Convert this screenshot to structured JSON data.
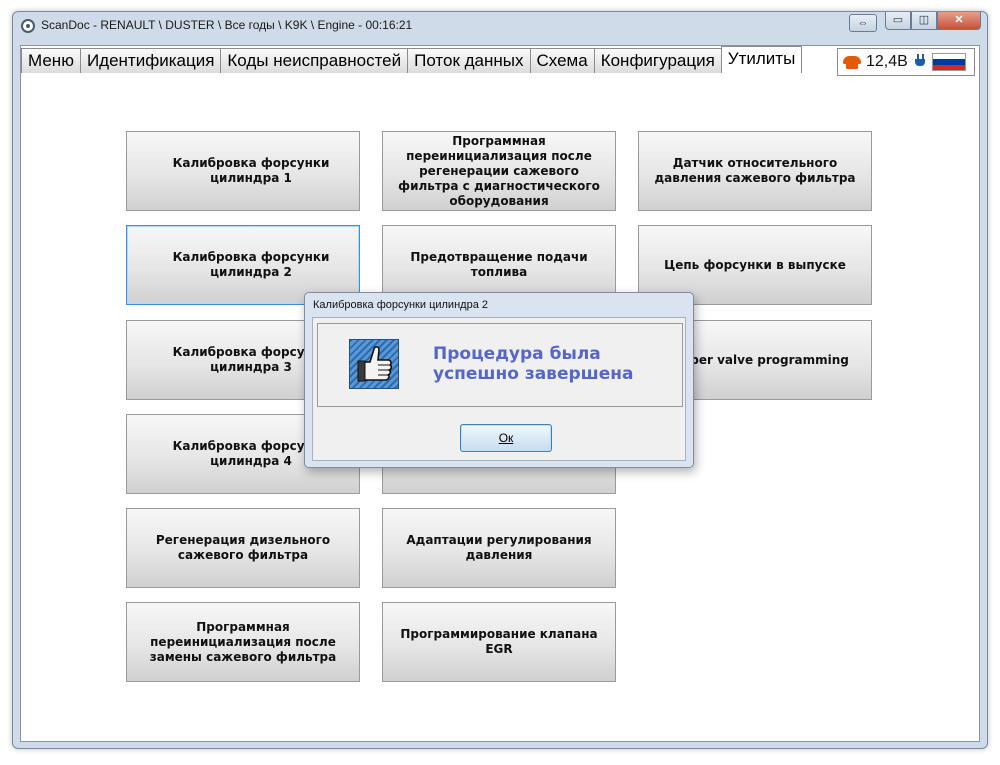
{
  "window": {
    "title": "ScanDoc - RENAULT \\ DUSTER \\ Все годы \\ K9K \\ Engine - 00:16:21"
  },
  "tabs": [
    {
      "label": "Меню"
    },
    {
      "label": "Идентификация"
    },
    {
      "label": "Коды неисправностей"
    },
    {
      "label": "Поток данных"
    },
    {
      "label": "Схема"
    },
    {
      "label": "Конфигурация"
    },
    {
      "label": "Утилиты",
      "active": true
    }
  ],
  "status": {
    "voltage": "12,4В",
    "colors": {
      "phone": "#e25b0b",
      "plug": "#1e5ea8"
    },
    "flag_colors": [
      "#ffffff",
      "#0039a6",
      "#d52b1e"
    ]
  },
  "functions": [
    "Калибровка форсунки цилиндра 1",
    "Программная переинициализация после регенерации сажевого фильтра с диагностического оборудования",
    "Датчик относительного давления сажевого фильтра",
    "Калибровка форсунки цилиндра 2",
    "Предотвращение подачи топлива",
    "Цепь форсунки в выпуске",
    "Калибровка форсунки цилиндра 3",
    "damper valve programming",
    "Калибровка форсунки цилиндра 4",
    "Регенерация дизельного сажевого фильтра",
    "Адаптации регулирования давления",
    "Программная переинициализация после замены сажевого фильтра",
    "Программирование клапана EGR"
  ],
  "dialog": {
    "title": "Калибровка форсунки цилиндра 2",
    "message": "Процедура была успешно завершена",
    "ok_label": "Ок",
    "icon": "thumbs-up-icon",
    "message_color": "#5566c8"
  }
}
